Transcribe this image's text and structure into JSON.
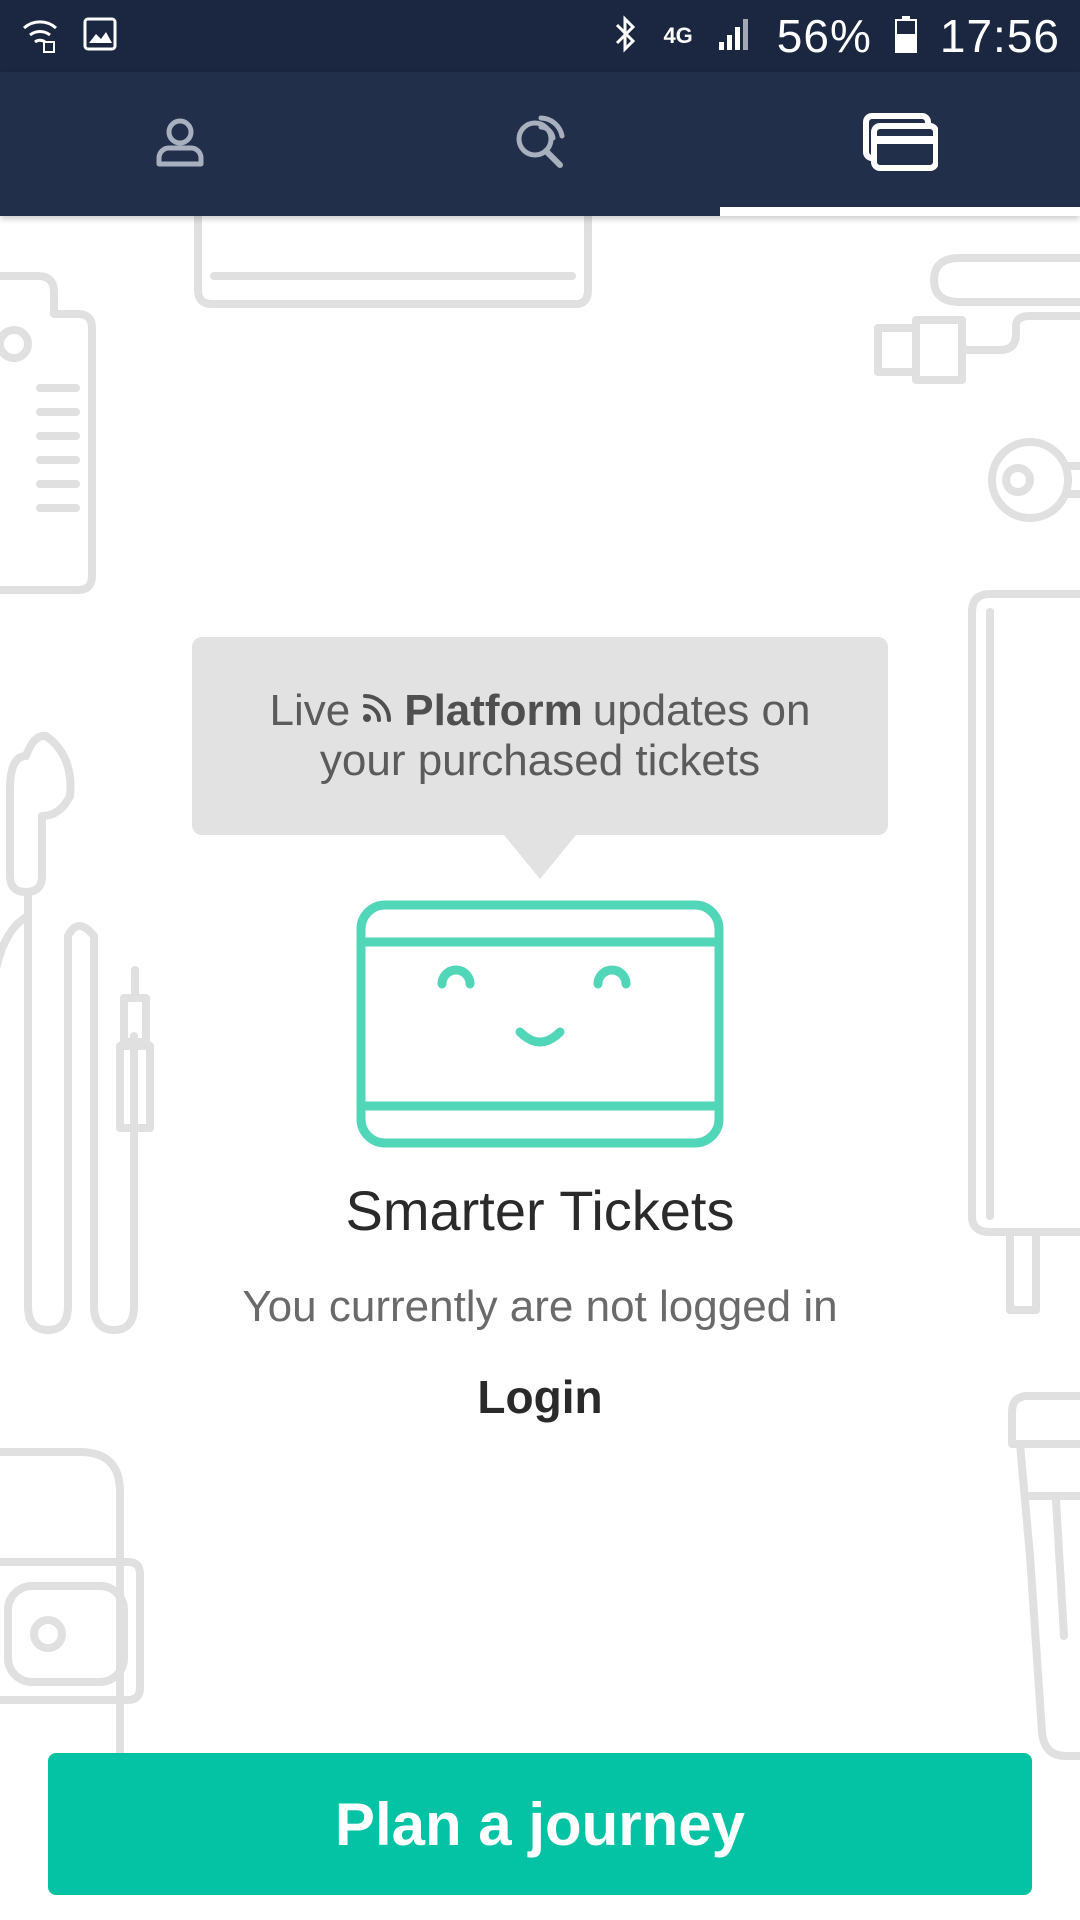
{
  "status_bar": {
    "network": "4G",
    "battery": "56%",
    "time": "17:56",
    "icons": [
      "wifi-icon",
      "gallery-icon",
      "bluetooth-icon",
      "signal-icon",
      "battery-icon"
    ]
  },
  "tabs": [
    {
      "icon": "profile-icon",
      "active": false
    },
    {
      "icon": "search-radar-icon",
      "active": false
    },
    {
      "icon": "tickets-icon",
      "active": true
    }
  ],
  "bubble": {
    "word_live": "Live",
    "word_platform": "Platform",
    "word_updates": "updates on",
    "line2": "your purchased tickets"
  },
  "main": {
    "title": "Smarter Tickets",
    "subtitle": "You currently are not logged in",
    "login_label": "Login"
  },
  "cta": {
    "label": "Plan a journey"
  },
  "colors": {
    "status_bar_bg": "#1b2640",
    "tab_bar_bg": "#212f4b",
    "accent": "#03c3a4",
    "ticket_outline": "#52d6b8",
    "bubble_bg": "#e2e2e2"
  }
}
